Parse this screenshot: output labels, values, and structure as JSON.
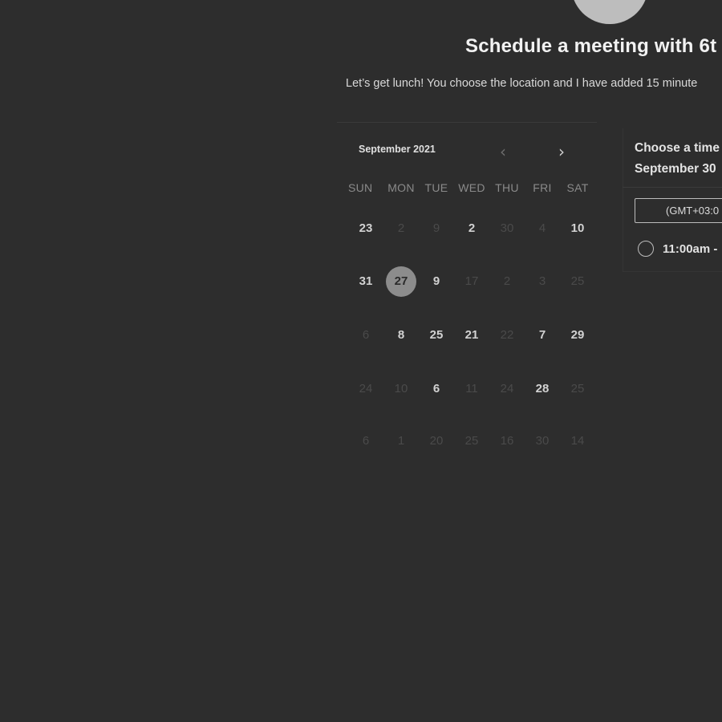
{
  "header": {
    "title": "Schedule a meeting with 6t",
    "subtitle": "Let’s get lunch! You choose the location and I have added 15 minute"
  },
  "calendar": {
    "month_label": "September 2021",
    "prev_icon": "chevron-left-icon",
    "next_icon": "chevron-right-icon",
    "weekdays": [
      "SUN",
      "MON",
      "TUE",
      "WED",
      "THU",
      "FRI",
      "SAT"
    ],
    "weeks": [
      [
        {
          "d": "23",
          "on": true
        },
        {
          "d": "2",
          "on": false
        },
        {
          "d": "9",
          "on": false
        },
        {
          "d": "2",
          "on": true
        },
        {
          "d": "30",
          "on": false
        },
        {
          "d": "4",
          "on": false
        },
        {
          "d": "10",
          "on": true
        }
      ],
      [
        {
          "d": "31",
          "on": true
        },
        {
          "d": "27",
          "on": true,
          "selected": true
        },
        {
          "d": "9",
          "on": true
        },
        {
          "d": "17",
          "on": false
        },
        {
          "d": "2",
          "on": false
        },
        {
          "d": "3",
          "on": false
        },
        {
          "d": "25",
          "on": false
        }
      ],
      [
        {
          "d": "6",
          "on": false
        },
        {
          "d": "8",
          "on": true
        },
        {
          "d": "25",
          "on": true
        },
        {
          "d": "21",
          "on": true
        },
        {
          "d": "22",
          "on": false
        },
        {
          "d": "7",
          "on": true
        },
        {
          "d": "29",
          "on": true
        }
      ],
      [
        {
          "d": "24",
          "on": false
        },
        {
          "d": "10",
          "on": false
        },
        {
          "d": "6",
          "on": true
        },
        {
          "d": "11",
          "on": false
        },
        {
          "d": "24",
          "on": false
        },
        {
          "d": "28",
          "on": true
        },
        {
          "d": "25",
          "on": false
        }
      ],
      [
        {
          "d": "6",
          "on": false
        },
        {
          "d": "1",
          "on": false
        },
        {
          "d": "20",
          "on": false
        },
        {
          "d": "25",
          "on": false
        },
        {
          "d": "16",
          "on": false
        },
        {
          "d": "30",
          "on": false
        },
        {
          "d": "14",
          "on": false
        }
      ]
    ]
  },
  "time_panel": {
    "heading_line1": "Choose a time",
    "heading_line2": "September 30",
    "timezone": "(GMT+03:0",
    "slots": [
      {
        "label": "11:00am -"
      }
    ]
  }
}
